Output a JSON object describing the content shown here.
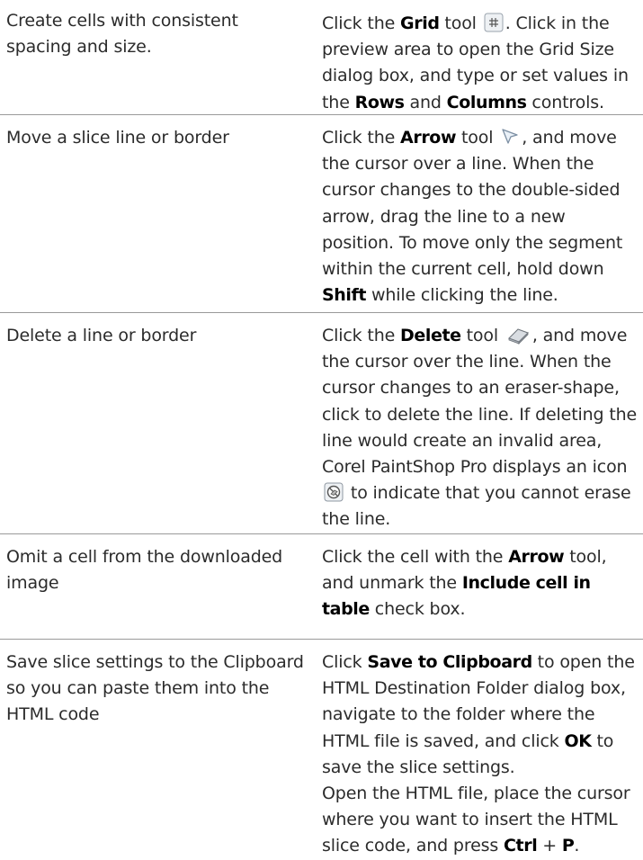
{
  "rows": [
    {
      "task": "Create cells with consistent spacing and size.",
      "desc": {
        "t1": "Click the ",
        "b1": "Grid",
        "t2": " tool ",
        "t3": ". Click in the preview area to open the Grid Size dialog box, and type or set values in the ",
        "b2": "Rows",
        "t4": " and ",
        "b3": "Columns",
        "t5": " controls."
      }
    },
    {
      "task": "Move a slice line or border",
      "desc": {
        "t1": "Click the ",
        "b1": "Arrow",
        "t2": " tool ",
        "t3": ", and move the cursor over a line. When the cursor changes to the double-sided arrow, drag the line to a new position. To move only the segment within the current cell, hold down ",
        "b2": "Shift",
        "t4": " while clicking the line."
      }
    },
    {
      "task": "Delete a line or border",
      "desc": {
        "t1": "Click the ",
        "b1": "Delete",
        "t2": " tool ",
        "t3": ", and move the cursor over the line. When the cursor changes to an eraser-shape, click to delete the line. If deleting the line would create an invalid area, Corel PaintShop Pro displays an icon ",
        "t4": " to indicate that you cannot erase the line."
      }
    },
    {
      "task": "Omit a cell from the downloaded image",
      "desc": {
        "t1": "Click the cell with the ",
        "b1": "Arrow",
        "t2": " tool, and unmark the ",
        "b2": "Include cell in table",
        "t3": " check box."
      }
    },
    {
      "task": "Save slice settings to the Clipboard so you can paste them into the HTML code",
      "desc": {
        "t1": "Click ",
        "b1": "Save to Clipboard",
        "t2": " to open the HTML Destination Folder dialog box, navigate to the folder where the HTML file is saved, and click ",
        "b2": "OK",
        "t3": " to save the slice settings.",
        "t4": "Open the HTML file, place the cursor where you want to insert the HTML slice code, and press ",
        "b3": "Ctrl",
        "t5": " + ",
        "b4": "P",
        "t6": "."
      }
    }
  ],
  "icons": {
    "grid": "grid-tool-icon",
    "arrow": "arrow-tool-icon",
    "delete": "delete-tool-icon",
    "invalid": "cannot-erase-icon"
  }
}
